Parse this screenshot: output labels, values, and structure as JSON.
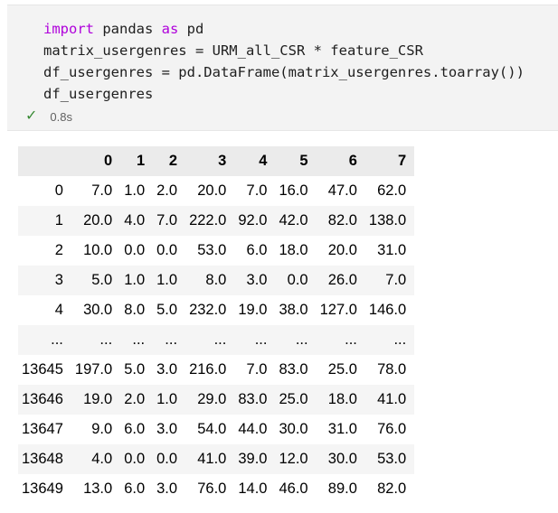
{
  "code_cell": {
    "lines": [
      [
        {
          "t": "import",
          "c": "kw"
        },
        {
          "t": " pandas ",
          "c": ""
        },
        {
          "t": "as",
          "c": "kw"
        },
        {
          "t": " pd",
          "c": ""
        }
      ],
      [
        {
          "t": "matrix_usergenres = URM_all_CSR * feature_CSR",
          "c": ""
        }
      ],
      [
        {
          "t": "df_usergenres = pd.DataFrame(matrix_usergenres.toarray())",
          "c": ""
        }
      ],
      [
        {
          "t": "df_usergenres",
          "c": ""
        }
      ]
    ],
    "status_icon": "check-icon",
    "exec_time": "0.8s"
  },
  "output_table": {
    "columns": [
      "",
      "0",
      "1",
      "2",
      "3",
      "4",
      "5",
      "6",
      "7"
    ],
    "rows": [
      [
        "0",
        "7.0",
        "1.0",
        "2.0",
        "20.0",
        "7.0",
        "16.0",
        "47.0",
        "62.0"
      ],
      [
        "1",
        "20.0",
        "4.0",
        "7.0",
        "222.0",
        "92.0",
        "42.0",
        "82.0",
        "138.0"
      ],
      [
        "2",
        "10.0",
        "0.0",
        "0.0",
        "53.0",
        "6.0",
        "18.0",
        "20.0",
        "31.0"
      ],
      [
        "3",
        "5.0",
        "1.0",
        "1.0",
        "8.0",
        "3.0",
        "0.0",
        "26.0",
        "7.0"
      ],
      [
        "4",
        "30.0",
        "8.0",
        "5.0",
        "232.0",
        "19.0",
        "38.0",
        "127.0",
        "146.0"
      ],
      [
        "...",
        "...",
        "...",
        "...",
        "...",
        "...",
        "...",
        "...",
        "..."
      ],
      [
        "13645",
        "197.0",
        "5.0",
        "3.0",
        "216.0",
        "7.0",
        "83.0",
        "25.0",
        "78.0"
      ],
      [
        "13646",
        "19.0",
        "2.0",
        "1.0",
        "29.0",
        "83.0",
        "25.0",
        "18.0",
        "41.0"
      ],
      [
        "13647",
        "9.0",
        "6.0",
        "3.0",
        "54.0",
        "44.0",
        "30.0",
        "31.0",
        "76.0"
      ],
      [
        "13648",
        "4.0",
        "0.0",
        "0.0",
        "41.0",
        "39.0",
        "12.0",
        "30.0",
        "53.0"
      ],
      [
        "13649",
        "13.0",
        "6.0",
        "3.0",
        "76.0",
        "14.0",
        "46.0",
        "89.0",
        "82.0"
      ]
    ]
  },
  "colors": {
    "keyword": "#af00db",
    "success": "#388a34",
    "cell_background": "#f3f3f3"
  }
}
